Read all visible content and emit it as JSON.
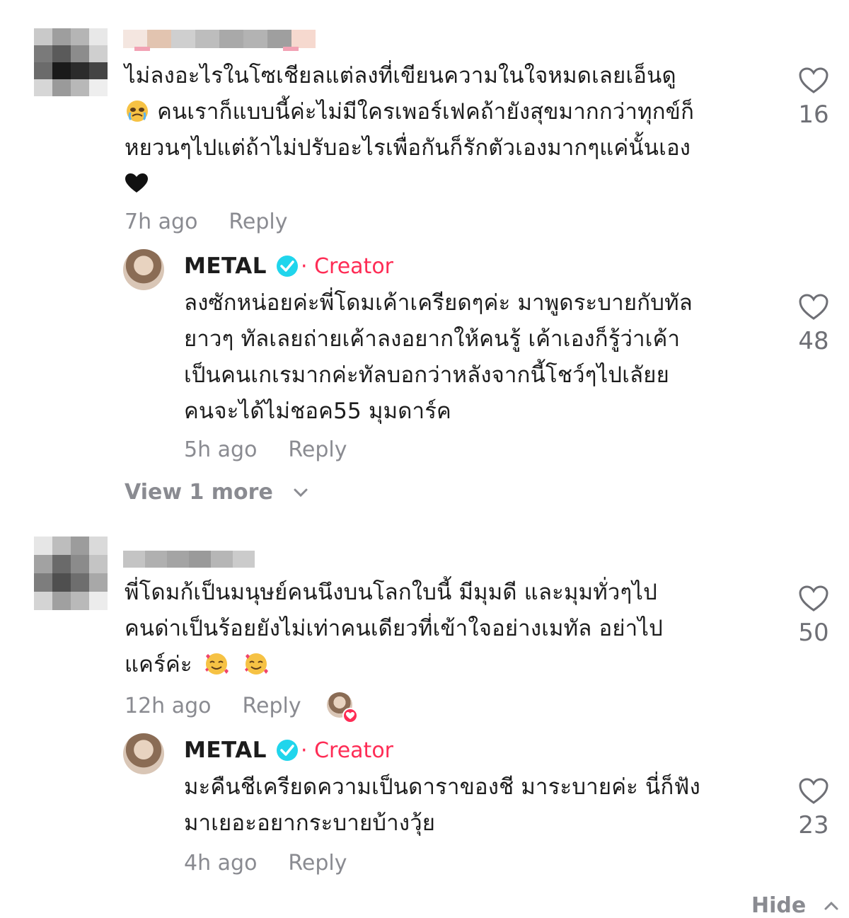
{
  "colors": {
    "accent": "#fe2c55",
    "verified": "#20d5ec",
    "muted": "#8a8b91"
  },
  "comments": [
    {
      "text_lines": [
        "ไม่ลงอะไรในโซเชียลแต่ลงที่เขียนความในใจหมดเลยเอ็นดู",
        "คนเราก็แบบนี้ค่ะไม่มีใครเพอร์เฟคถ้ายังสุขมากกว่าทุกข์ก็",
        "หยวนๆไปแต่ถ้าไม่ปรับอะไรเพื่อกันก็รักตัวเองมากๆแค่นั้นเอง"
      ],
      "time": "7h ago",
      "reply_label": "Reply",
      "likes": "16",
      "reply": {
        "author": "METAL",
        "badge": "· Creator",
        "text_lines": [
          "ลงซักหน่อยค่ะพี่โดมเค้าเครียดๆค่ะ มาพูดระบายกับทัล",
          "ยาวๆ ทัลเลยถ่ายเค้าลงอยากให้คนรู้ เค้าเองก็รู้ว่าเค้า",
          "เป็นคนเกเรมากค่ะทัลบอกว่าหลังจากนี้โชว์ๆไปเลัยย",
          "คนจะได้ไม่ชอค55 มุมดาร์ค"
        ],
        "time": "5h ago",
        "reply_label": "Reply",
        "likes": "48"
      },
      "view_more": "View 1 more"
    },
    {
      "text_lines": [
        "พี่โดมก้เป็นมนุษย์คนนึงบนโลกใบนี้ มีมุมดี และมุมทั่วๆไป",
        "คนด่าเป็นร้อยยังไม่เท่าคนเดียวที่เข้าใจอย่างเมทัล อย่าไป",
        "แคร์ค่ะ"
      ],
      "time": "12h ago",
      "reply_label": "Reply",
      "likes": "50",
      "reply": {
        "author": "METAL",
        "badge": "· Creator",
        "text_lines": [
          "มะคืนชีเครียดความเป็นดาราของชี มาระบายค่ะ นี่ก็ฟัง",
          "มาเยอะอยากระบายบ้างวุ้ย"
        ],
        "time": "4h ago",
        "reply_label": "Reply",
        "likes": "23"
      }
    }
  ],
  "hide_label": "Hide"
}
